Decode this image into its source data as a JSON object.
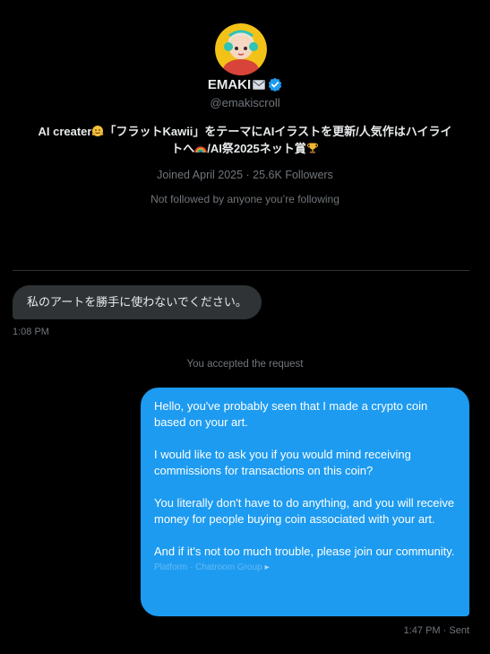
{
  "profile": {
    "display_name": "EMAKI",
    "handle": "@emakiscroll",
    "bio_line1_a": "AI creater",
    "bio_line1_b": "「フラットKawii」をテーマにAIイラストを更新/人気作はハイライ",
    "bio_line2_a": "トへ",
    "bio_line2_b": "/AI祭2025ネット賞",
    "joined_followers": "Joined April 2025 · 25.6K Followers",
    "followed_note": "Not followed by anyone you’re following",
    "icons": {
      "name_badge": "envelope-icon",
      "verified": "verified-badge-icon",
      "bio_emoji_1": "hugging-face-emoji-icon",
      "bio_emoji_2": "rainbow-emoji-icon",
      "bio_emoji_3": "trophy-emoji-icon"
    }
  },
  "conversation": {
    "incoming_message": "私のアートを勝手に使わないでください。",
    "incoming_time": "1:08 PM",
    "system_note": "You accepted the request",
    "outgoing_paragraphs": [
      "Hello, you've probably seen that I made a crypto coin based on your art.",
      "I would like to ask you if you would mind receiving commissions for transactions on this coin?",
      "You literally don't have to do anything, and you will receive money for people buying coin associated with your art.",
      "And if it's not too much trouble, please join our community."
    ],
    "outgoing_link_text": "Platform · Chatroom Group",
    "outgoing_status": "1:47 PM · Sent"
  },
  "colors": {
    "background": "#000000",
    "accent_blue": "#1d9bf0",
    "incoming_bubble": "#2f3336",
    "muted_text": "#71767b",
    "primary_text": "#e7e9ea"
  }
}
